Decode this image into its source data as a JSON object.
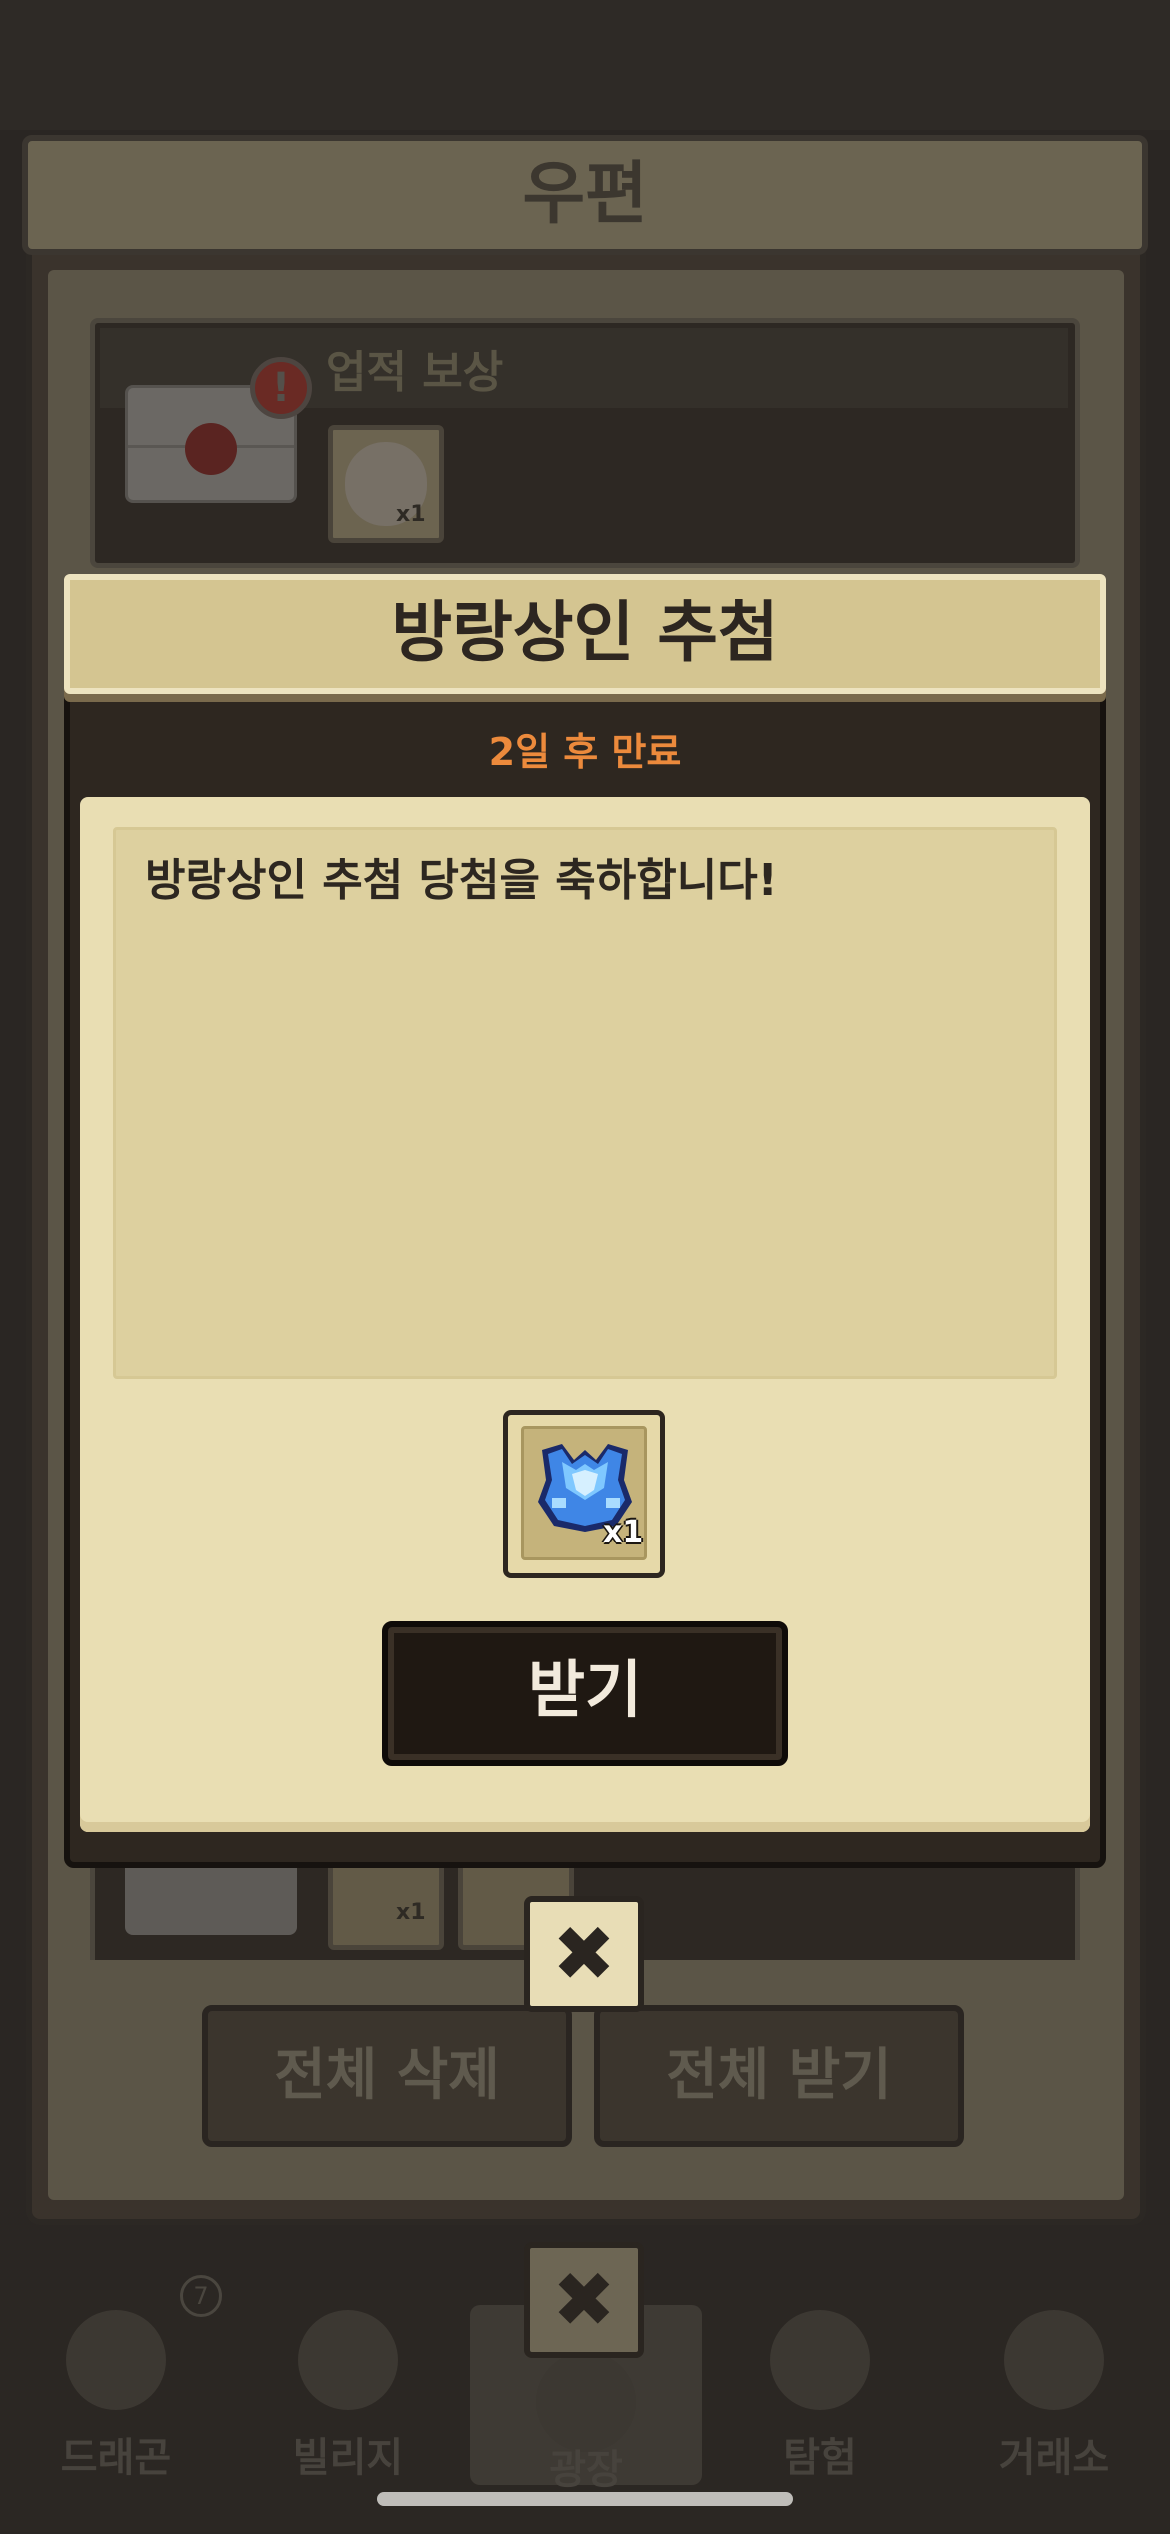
{
  "mailbox": {
    "title": "우편",
    "item": {
      "title": "업적 보상",
      "alert_glyph": "!",
      "reward_count": "x1"
    },
    "item2_reward_count": "x1",
    "delete_all_label": "전체 삭제",
    "receive_all_label": "전체 받기"
  },
  "modal": {
    "title": "방랑상인 추첨",
    "expiry": "2일 후 만료",
    "message": "방랑상인 추첨 당첨을 축하합니다!",
    "reward": {
      "icon": "blue-crystal-armor-icon",
      "count": "x1"
    },
    "receive_label": "받기",
    "close_glyph": "✖"
  },
  "bottom_nav": {
    "items": [
      {
        "label": "드래곤",
        "icon": "dragon-icon"
      },
      {
        "label": "빌리지",
        "icon": "village-icon"
      },
      {
        "label": "광장",
        "icon": "plaza-icon"
      },
      {
        "label": "탐험",
        "icon": "compass-icon"
      },
      {
        "label": "거래소",
        "icon": "merchant-icon"
      }
    ],
    "badge": "7",
    "close_glyph": "✖"
  },
  "colors": {
    "accent_orange": "#ec8a3c",
    "parchment": "#e9deb3",
    "dark_frame": "#2e2720"
  }
}
